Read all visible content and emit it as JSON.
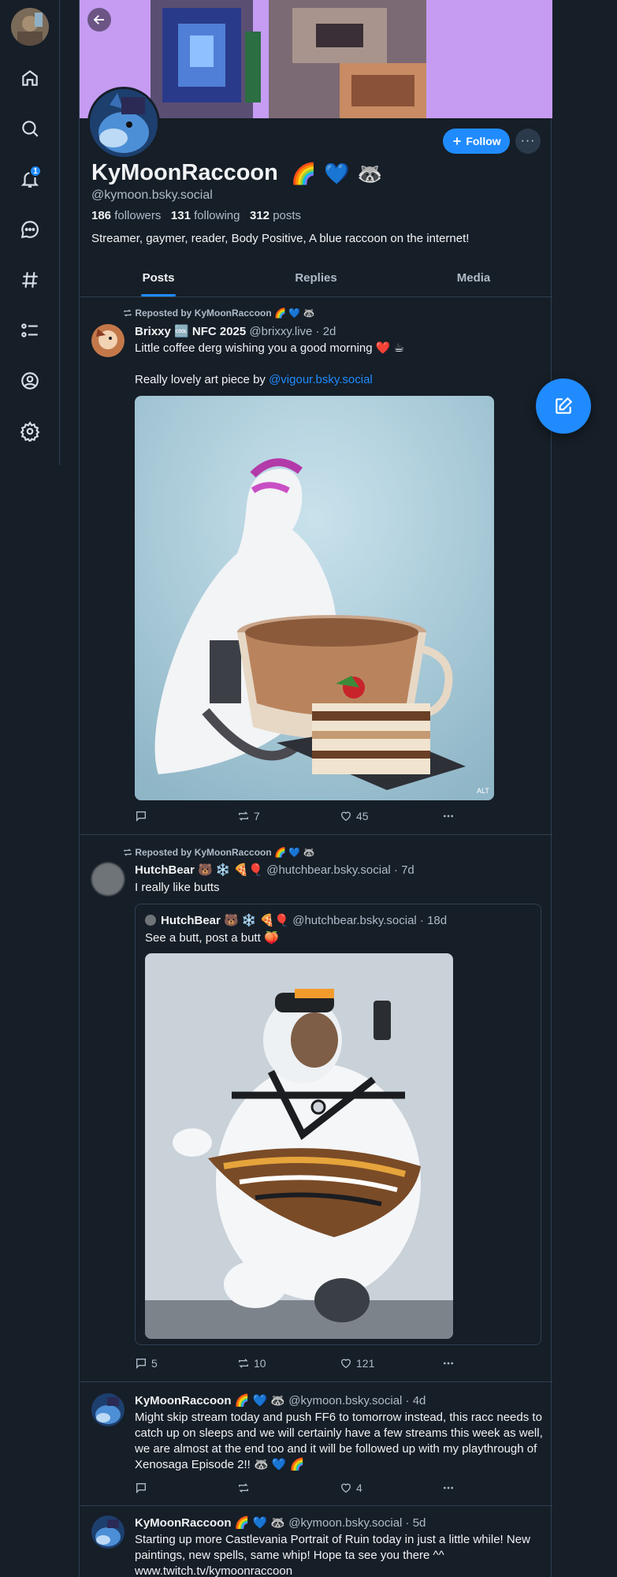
{
  "profile": {
    "display_name": "KyMoonRaccoon",
    "name_emoji": [
      "🌈",
      "💙",
      "🦝"
    ],
    "handle": "@kymoon.bsky.social",
    "followers_count": "186",
    "followers_label": "followers",
    "following_count": "131",
    "following_label": "following",
    "posts_count": "312",
    "posts_label": "posts",
    "bio": "Streamer, gaymer, reader, Body Positive, A blue raccoon on the internet!",
    "follow_label": "Follow",
    "more_label": "···"
  },
  "nav": {
    "notifications_badge": "1",
    "icons": [
      "home-icon",
      "search-icon",
      "bell-icon",
      "chat-icon",
      "hashtag-icon",
      "list-icon",
      "profile-icon",
      "settings-icon"
    ]
  },
  "tabs": [
    {
      "label": "Posts",
      "active": true
    },
    {
      "label": "Replies",
      "active": false
    },
    {
      "label": "Media",
      "active": false
    }
  ],
  "feed": [
    {
      "reposted_by": "Reposted by KyMoonRaccoon 🌈 💙 🦝",
      "author_name": "Brixxy 🆒 NFC 2025",
      "author_handle": "@brixxy.live · 2d",
      "text_line1": "Little coffee derg wishing you a good morning ❤️ ☕",
      "text_line2_prefix": "Really lovely art piece by ",
      "text_line2_link": "@vigour.bsky.social",
      "image_alt_badge": "ALT",
      "replies": "",
      "reposts": "7",
      "likes": "45"
    },
    {
      "reposted_by": "Reposted by KyMoonRaccoon 🌈 💙 🦝",
      "author_name": "HutchBear 🐻 ❄️ 🍕🎈",
      "author_handle": "@hutchbear.bsky.social · 7d",
      "text": "I really like butts",
      "quote": {
        "author_name": "HutchBear 🐻 ❄️ 🍕🎈",
        "author_handle": "@hutchbear.bsky.social · 18d",
        "text": "See a butt, post a butt 🍑"
      },
      "replies": "5",
      "reposts": "10",
      "likes": "121"
    },
    {
      "author_name": "KyMoonRaccoon 🌈 💙 🦝",
      "author_handle": "@kymoon.bsky.social · 4d",
      "text": "Might skip stream today and push FF6 to tomorrow instead, this racc needs to catch up on sleeps and we will certainly have a few streams this week as well, we are almost at the end too and it will be followed up with my playthrough of Xenosaga Episode 2!! 🦝 💙 🌈",
      "replies": "",
      "reposts": "",
      "likes": "4"
    },
    {
      "author_name": "KyMoonRaccoon 🌈 💙 🦝",
      "author_handle": "@kymoon.bsky.social · 5d",
      "text": "Starting up more Castlevania Portrait of Ruin today in just a little while! New paintings, new spells, same whip! Hope ta see you there ^^",
      "link": "www.twitch.tv/kymoonraccoon"
    }
  ]
}
